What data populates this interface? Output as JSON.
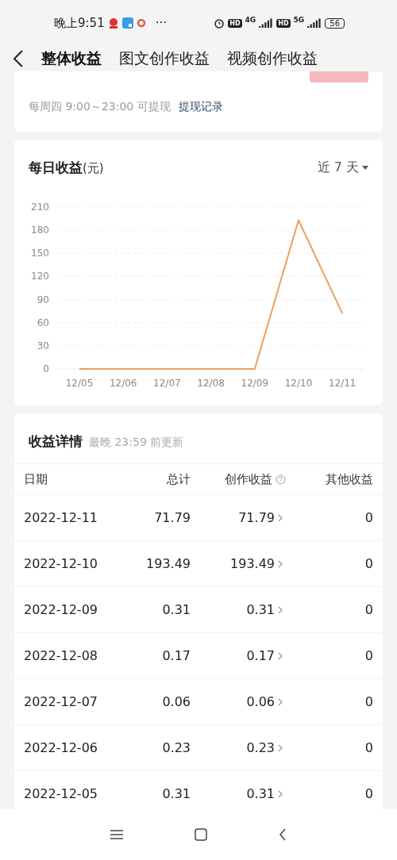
{
  "status_bar": {
    "time": "晚上9:51",
    "more": "···",
    "hd_1": "HD",
    "network_1": "4G",
    "hd_2": "HD",
    "network_2": "5G",
    "battery": "56"
  },
  "header": {
    "tabs": [
      {
        "label": "整体收益",
        "selected": true
      },
      {
        "label": "图文创作收益",
        "selected": false
      },
      {
        "label": "视频创作收益",
        "selected": false
      }
    ]
  },
  "balance_card": {
    "schedule": "每周四 9:00～23:00 可提现",
    "history_link": "提现记录"
  },
  "daily_card": {
    "title": "每日收益",
    "unit": "(元)",
    "range": "近 7 天",
    "chart_data": {
      "type": "line",
      "categories": [
        "12/05",
        "12/06",
        "12/07",
        "12/08",
        "12/09",
        "12/10",
        "12/11"
      ],
      "series": [
        {
          "color": "#e9a15e",
          "values": [
            0,
            0,
            0,
            0,
            0,
            193,
            72
          ]
        }
      ],
      "grid": true,
      "ylim": [
        0,
        210
      ],
      "yticks": [
        0,
        30,
        60,
        90,
        120,
        150,
        180,
        210
      ]
    }
  },
  "details_card": {
    "title": "收益详情",
    "note": "最晚 23:59 前更新",
    "columns": [
      "日期",
      "总计",
      "创作收益",
      "其他收益"
    ],
    "rows": [
      {
        "date": "2022-12-11",
        "total": "71.79",
        "creation": "71.79",
        "other": "0"
      },
      {
        "date": "2022-12-10",
        "total": "193.49",
        "creation": "193.49",
        "other": "0"
      },
      {
        "date": "2022-12-09",
        "total": "0.31",
        "creation": "0.31",
        "other": "0"
      },
      {
        "date": "2022-12-08",
        "total": "0.17",
        "creation": "0.17",
        "other": "0"
      },
      {
        "date": "2022-12-07",
        "total": "0.06",
        "creation": "0.06",
        "other": "0"
      },
      {
        "date": "2022-12-06",
        "total": "0.23",
        "creation": "0.23",
        "other": "0"
      },
      {
        "date": "2022-12-05",
        "total": "0.31",
        "creation": "0.31",
        "other": "0"
      }
    ]
  }
}
